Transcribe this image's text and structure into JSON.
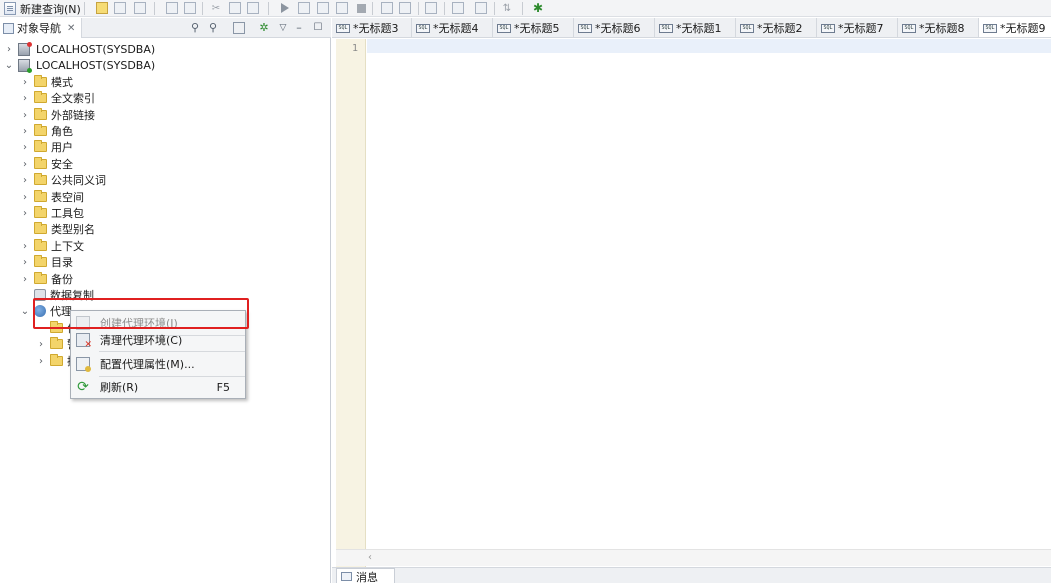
{
  "toolbar": {
    "new_query_label": "新建查询(N)"
  },
  "navigator": {
    "tab_label": "对象导航",
    "tab_close": "✕",
    "servers": [
      {
        "label": "LOCALHOST(SYSDBA)",
        "expanded": false,
        "status": "error"
      },
      {
        "label": "LOCALHOST(SYSDBA)",
        "expanded": true,
        "status": "connected"
      }
    ],
    "nodes": [
      {
        "label": "模式",
        "expander": "›",
        "icon": "folder-icon"
      },
      {
        "label": "全文索引",
        "expander": "›",
        "icon": "folder-icon"
      },
      {
        "label": "外部链接",
        "expander": "›",
        "icon": "folder-icon"
      },
      {
        "label": "角色",
        "expander": "›",
        "icon": "folder-icon"
      },
      {
        "label": "用户",
        "expander": "›",
        "icon": "folder-icon"
      },
      {
        "label": "安全",
        "expander": "›",
        "icon": "folder-icon"
      },
      {
        "label": "公共同义词",
        "expander": "›",
        "icon": "folder-icon"
      },
      {
        "label": "表空间",
        "expander": "›",
        "icon": "folder-icon"
      },
      {
        "label": "工具包",
        "expander": "›",
        "icon": "folder-icon"
      },
      {
        "label": "类型别名",
        "expander": "",
        "icon": "folder-icon"
      },
      {
        "label": "上下文",
        "expander": "›",
        "icon": "folder-icon"
      },
      {
        "label": "目录",
        "expander": "›",
        "icon": "folder-icon"
      },
      {
        "label": "备份",
        "expander": "›",
        "icon": "folder-icon"
      },
      {
        "label": "数据复制",
        "expander": "",
        "icon": "replication-icon"
      },
      {
        "label": "代理",
        "expander": "⌄",
        "icon": "agent-icon"
      }
    ],
    "agent_children": [
      {
        "label": "作",
        "expander": "",
        "icon": "folder-icon"
      },
      {
        "label": "警",
        "expander": "›",
        "icon": "folder-icon"
      },
      {
        "label": "操",
        "expander": "›",
        "icon": "folder-icon"
      }
    ]
  },
  "editor": {
    "tabs": [
      "*无标题3",
      "*无标题4",
      "*无标题5",
      "*无标题6",
      "*无标题1",
      "*无标题2",
      "*无标题7",
      "*无标题8",
      "*无标题9"
    ],
    "sql_icon_text": "SQL",
    "active_tab_index": 8,
    "line_number": "1",
    "messages_tab": "消息"
  },
  "context_menu": {
    "items": [
      {
        "label": "创建代理环境(I)",
        "enabled": false,
        "shortcut": ""
      },
      {
        "label": "清理代理环境(C)",
        "enabled": true,
        "shortcut": ""
      },
      {
        "label": "配置代理属性(M)...",
        "enabled": true,
        "shortcut": ""
      },
      {
        "label": "刷新(R)",
        "enabled": true,
        "shortcut": "F5"
      }
    ],
    "highlight_color": "#e02020"
  }
}
